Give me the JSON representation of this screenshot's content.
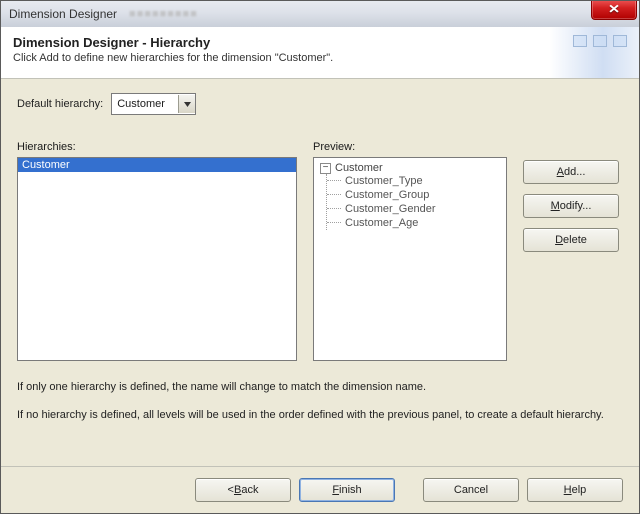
{
  "titlebar": {
    "title": "Dimension Designer"
  },
  "header": {
    "title": "Dimension Designer - Hierarchy",
    "subtitle": "Click Add to define new hierarchies for the dimension \"Customer\"."
  },
  "defaultHierarchy": {
    "label": "Default hierarchy:",
    "value": "Customer"
  },
  "hierarchies": {
    "label": "Hierarchies:",
    "items": [
      "Customer"
    ],
    "selectedIndex": 0
  },
  "preview": {
    "label": "Preview:",
    "root": "Customer",
    "children": [
      "Customer_Type",
      "Customer_Group",
      "Customer_Gender",
      "Customer_Age"
    ]
  },
  "sideButtons": {
    "add_full": "Add...",
    "add_key": "A",
    "add_rest": "dd...",
    "modify_full": "Modify...",
    "modify_key": "M",
    "modify_rest": "odify...",
    "delete_full": "Delete",
    "delete_key": "D",
    "delete_rest": "elete"
  },
  "hints": {
    "line1": "If only one hierarchy is defined, the name will change to match the dimension name.",
    "line2": "If no hierarchy is defined, all levels will be used in the order defined with the previous panel, to create a default hierarchy."
  },
  "bottom": {
    "back_lt": "< ",
    "back_key": "B",
    "back_rest": "ack",
    "finish_key": "F",
    "finish_rest": "inish",
    "cancel": "Cancel",
    "help_key": "H",
    "help_rest": "elp"
  }
}
